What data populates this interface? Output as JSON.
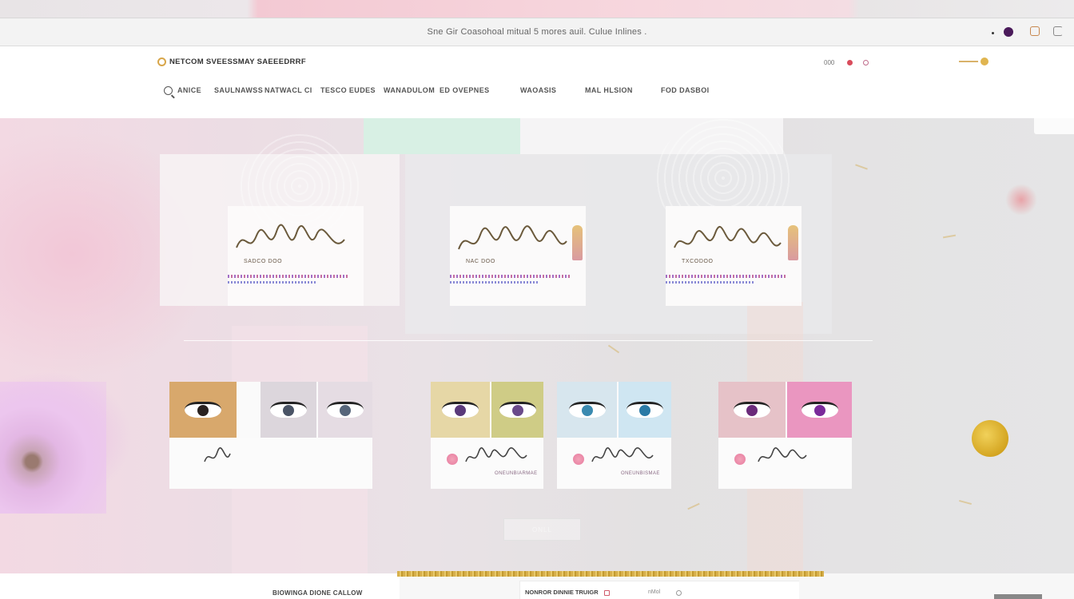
{
  "announcement": {
    "text": "Sne Gir Coasohoal mitual 5 mores auil. Culue Inlines ."
  },
  "header": {
    "logo_text": "NETCOM SVEESSMAY SAEEEDRRF",
    "util_text": "000",
    "nav": [
      {
        "label": "ANICE"
      },
      {
        "label": "SAULNAWSS"
      },
      {
        "label": "NATWACL CI"
      },
      {
        "label": "TESCO EUDES"
      },
      {
        "label": "WANADULOM"
      },
      {
        "label": "ED OVEPNES"
      },
      {
        "label": "WAOASIS"
      },
      {
        "label": "MAL HLSION"
      },
      {
        "label": "FOD DASBOI"
      }
    ]
  },
  "hero": {
    "signature_cards": [
      {
        "caption": "SADCO DOO"
      },
      {
        "caption": "NAC DOO"
      },
      {
        "caption": "TXCODOO"
      }
    ],
    "products": [
      {
        "caption": ""
      },
      {
        "caption": "ONEUNBIARMAE"
      },
      {
        "caption": "ONEUNBISMAE"
      },
      {
        "caption": ""
      }
    ],
    "cta_label": "ONLL"
  },
  "footer": {
    "left_text": "BIOWINGA DIONE CALLOW",
    "box_text": "NONROR DINNIE TRUIGR",
    "tiny_text": "nMol"
  },
  "colors": {
    "accent_purple": "#4a1a5a",
    "accent_gold": "#d7b04c",
    "hero_pink": "#f2c7d7"
  }
}
